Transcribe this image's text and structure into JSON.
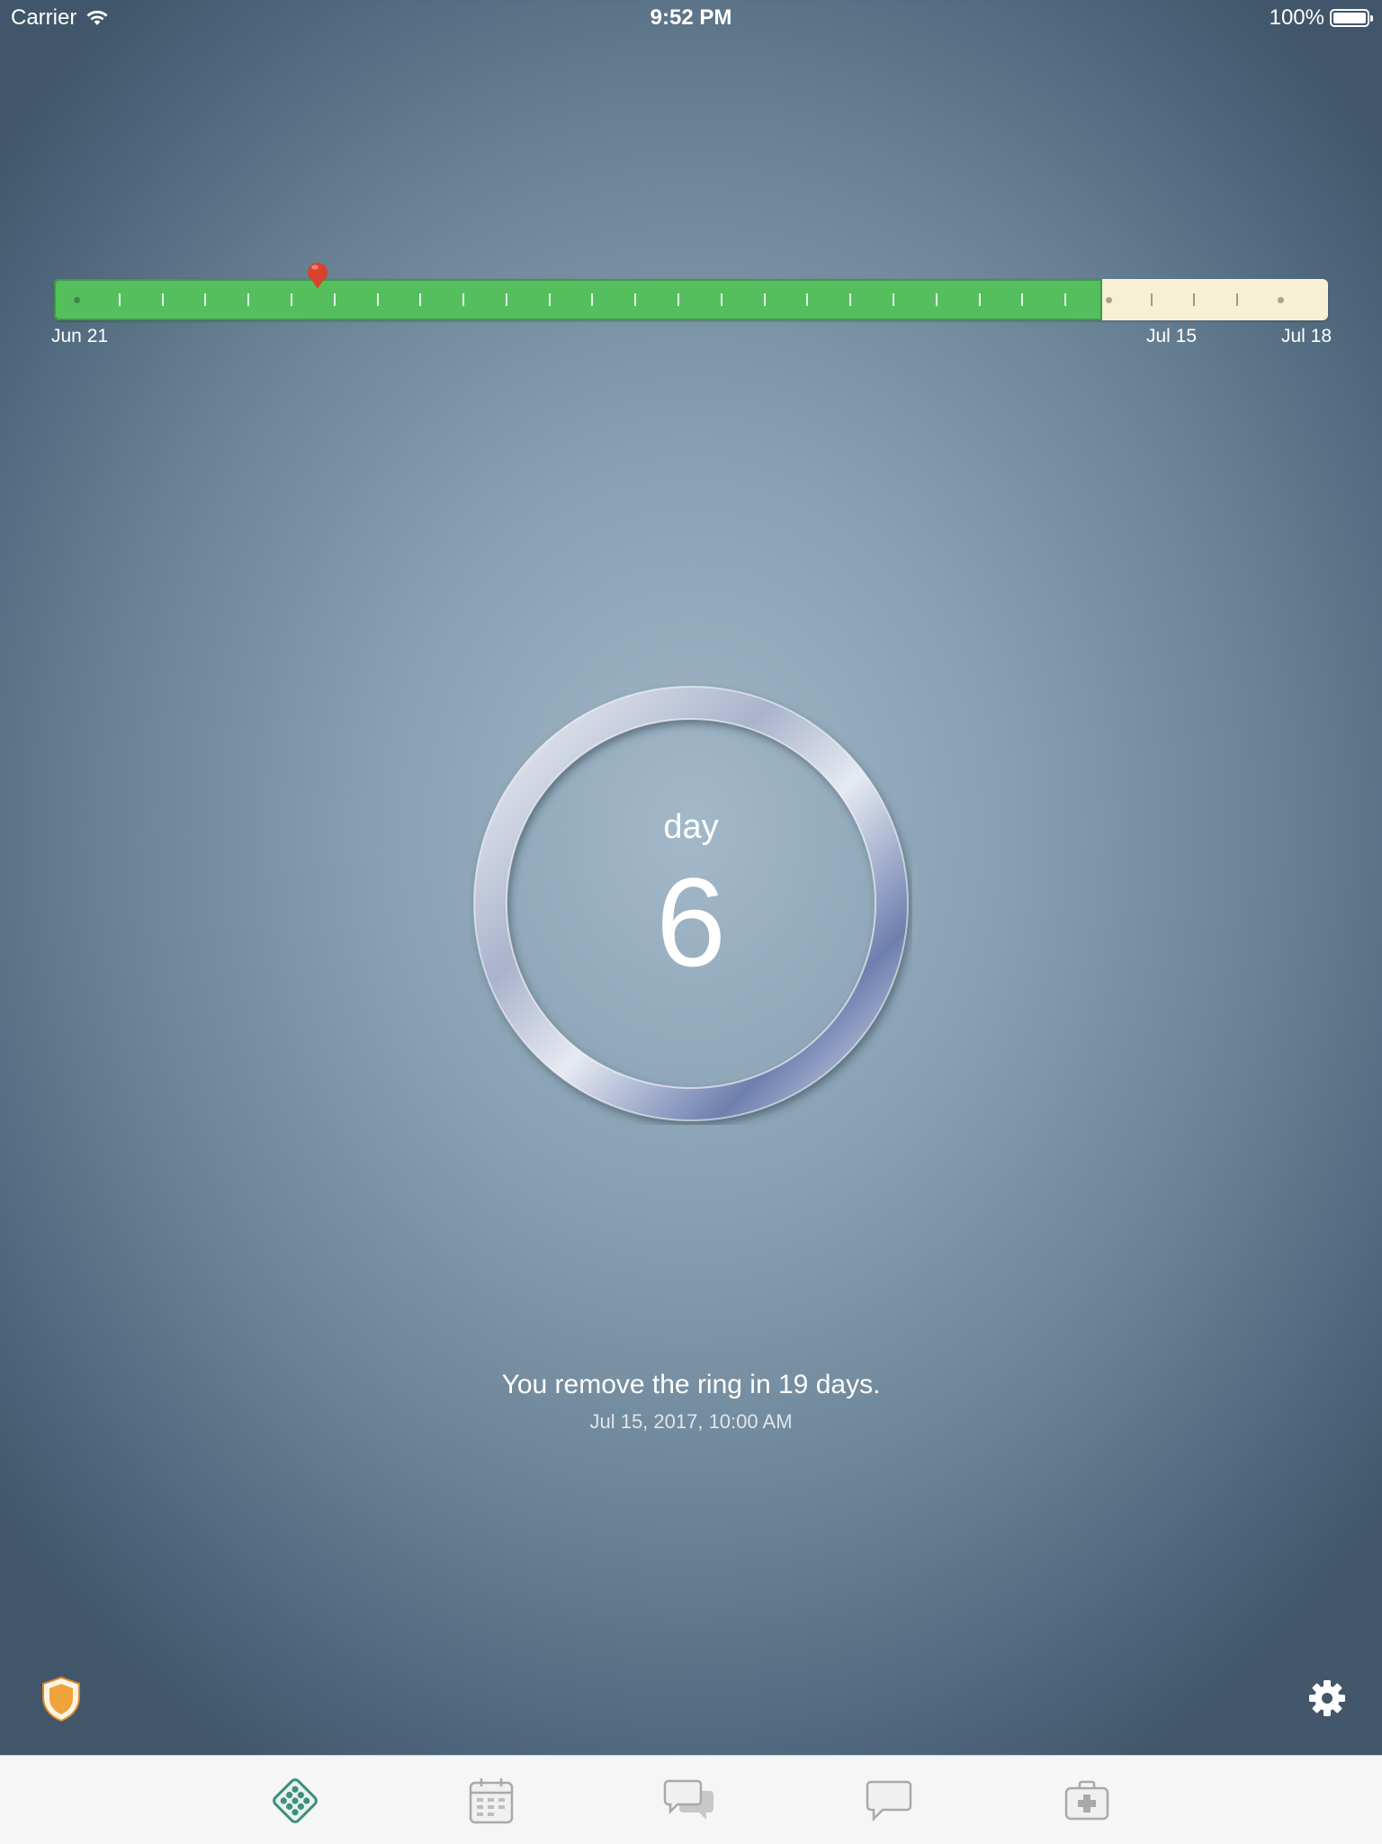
{
  "status_bar": {
    "carrier": "Carrier",
    "time": "9:52 PM",
    "battery": "100%",
    "battery_level": 1.0
  },
  "timeline": {
    "start_label": "Jun 21",
    "remove_label": "Jul 15",
    "end_label": "Jul 18",
    "total_days": 28,
    "ring_days": 24,
    "current_day": 6,
    "fill_color": "#55bf5e",
    "rest_color": "#f7f0d4",
    "marker_color": "#d9432b"
  },
  "ring": {
    "day_label": "day",
    "day_number": "6"
  },
  "info": {
    "message": "You remove the ring in 19 days.",
    "date": "Jul 15, 2017, 10:00 AM"
  },
  "icons": {
    "protection": "shield-icon",
    "settings": "gear-icon",
    "tabs": [
      "pill-pack-icon",
      "calendar-icon",
      "chat-bubbles-icon",
      "chat-bubble-icon",
      "medical-kit-icon"
    ]
  },
  "colors": {
    "tab_active": "#3f8f7a",
    "tab_inactive": "#a9a9a9",
    "shield": "#f0a23b"
  }
}
